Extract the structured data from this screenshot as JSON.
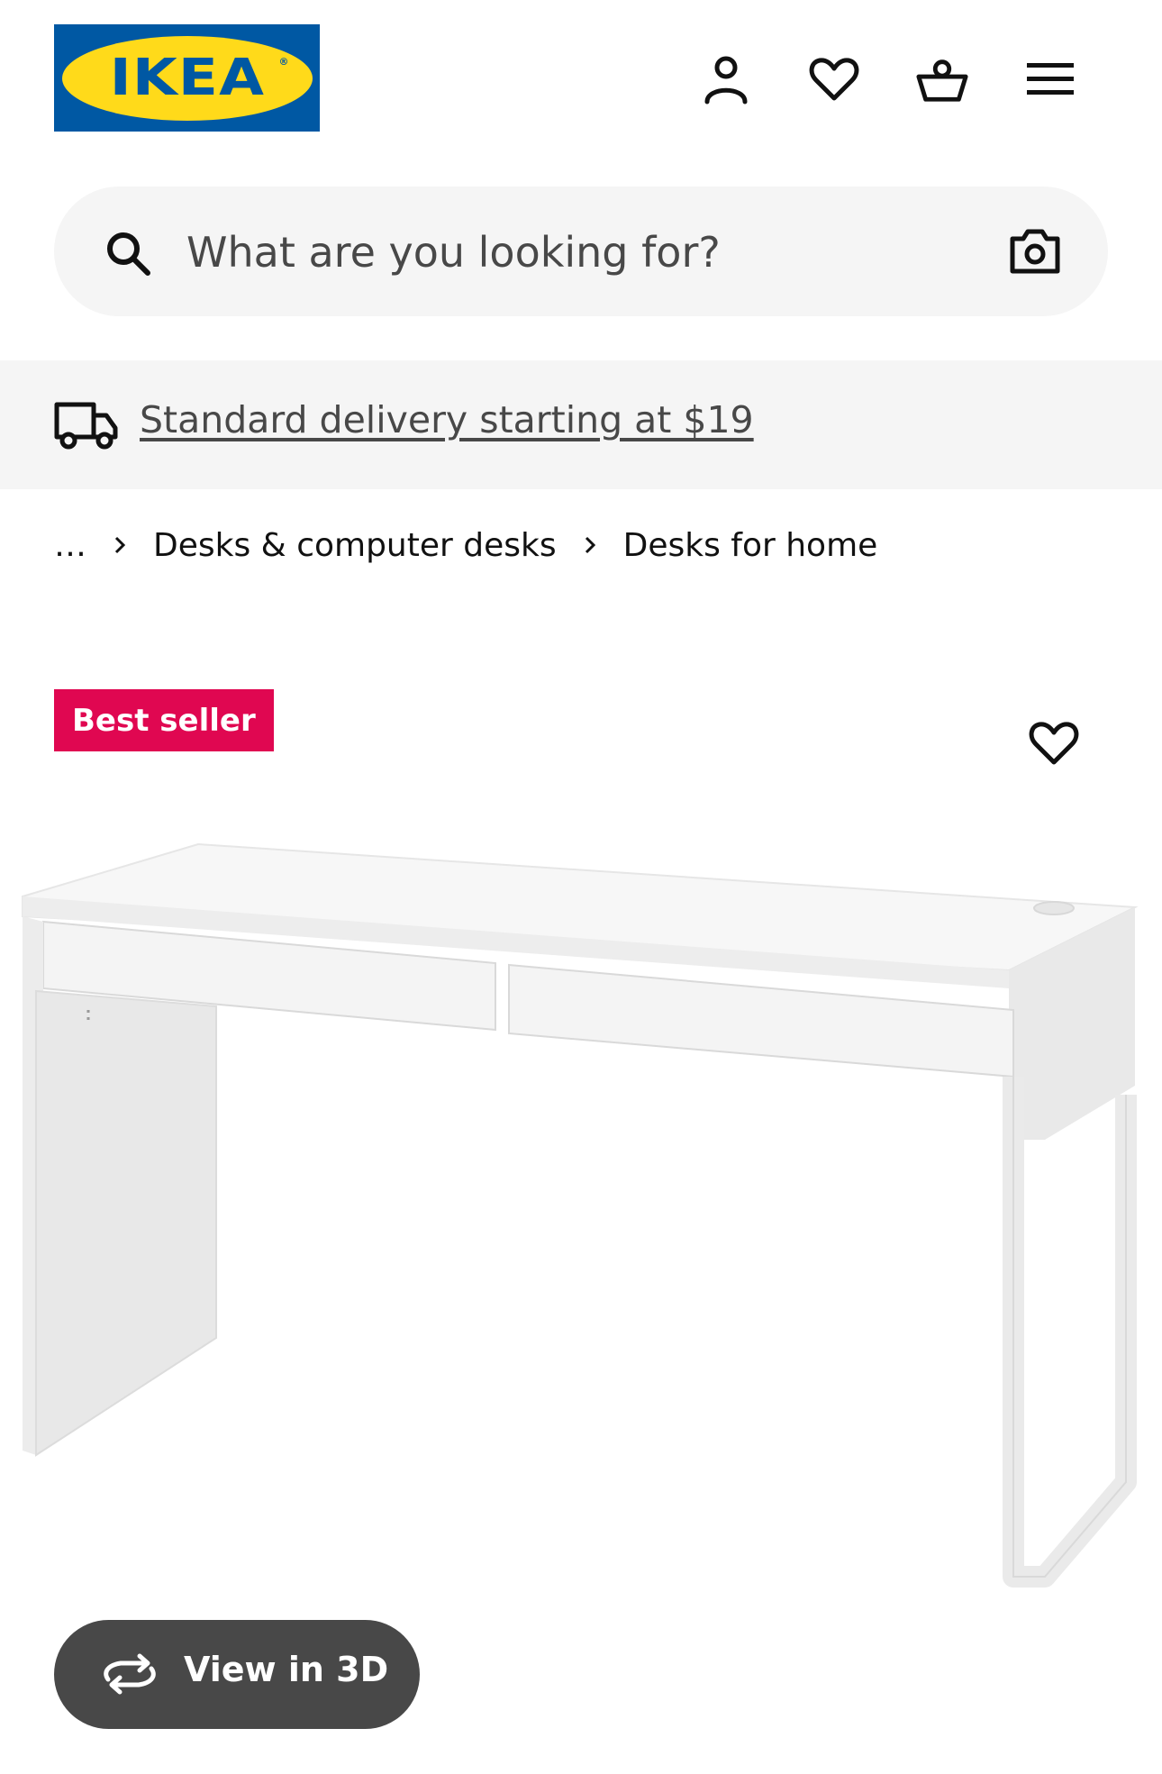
{
  "header": {
    "logo_text": "IKEA",
    "logo_reg": "®",
    "icons": [
      "account-icon",
      "heart-icon",
      "basket-icon",
      "menu-icon"
    ]
  },
  "search": {
    "placeholder": "What are you looking for?",
    "icons": [
      "search-icon",
      "camera-icon"
    ]
  },
  "banner": {
    "text": "Standard delivery starting at $19",
    "icon": "truck-icon"
  },
  "breadcrumb": {
    "items": [
      "…",
      "Desks & computer desks",
      "Desks for home"
    ]
  },
  "product": {
    "badge": "Best seller",
    "view3d_label": "View in 3D",
    "image_subject": "white desk with two drawers"
  },
  "colors": {
    "ikea_blue": "#0058a3",
    "ikea_yellow": "#ffda1a",
    "badge_pink": "#e00751",
    "button_dark": "#484848",
    "light_gray": "#f5f5f5"
  }
}
